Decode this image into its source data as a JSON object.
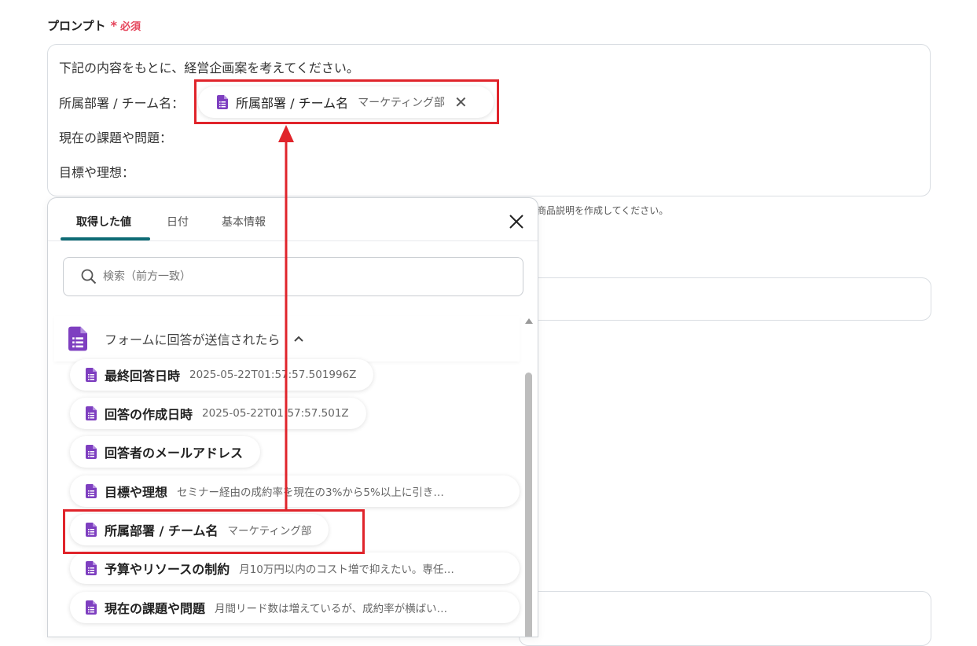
{
  "field": {
    "label": "プロンプト",
    "required_mark": "*",
    "required_text": "必須"
  },
  "prompt": {
    "line1": "下記の内容をもとに、経営企画案を考えてください。",
    "line2": "所属部署 / チーム名：",
    "line3": "現在の課題や問題：",
    "line4": "目標や理想："
  },
  "inserted_chip": {
    "label": "所属部署 / チーム名",
    "value": "マーケティング部"
  },
  "helper_text": "商品説明を作成してください。",
  "popup": {
    "tabs": [
      "取得した値",
      "日付",
      "基本情報"
    ],
    "search_placeholder": "検索（前方一致）",
    "group_title": "フォームに回答が送信されたら",
    "items": [
      {
        "label": "最終回答日時",
        "value": "2025-05-22T01:57:57.501996Z"
      },
      {
        "label": "回答の作成日時",
        "value": "2025-05-22T01:57:57.501Z"
      },
      {
        "label": "回答者のメールアドレス",
        "value": ""
      },
      {
        "label": "目標や理想",
        "value": "セミナー経由の成約率を現在の3%から5%以上に引き…"
      },
      {
        "label": "所属部署 / チーム名",
        "value": "マーケティング部"
      },
      {
        "label": "予算やリソースの制約",
        "value": "月10万円以内のコスト増で抑えたい。専任…"
      },
      {
        "label": "現在の課題や問題",
        "value": "月間リード数は増えているが、成約率が横ばい…"
      }
    ]
  },
  "colors": {
    "accent_tab": "#0e6b75",
    "required": "#e5435a",
    "highlight": "#e0242b",
    "form_icon": "#7e3fc0"
  }
}
